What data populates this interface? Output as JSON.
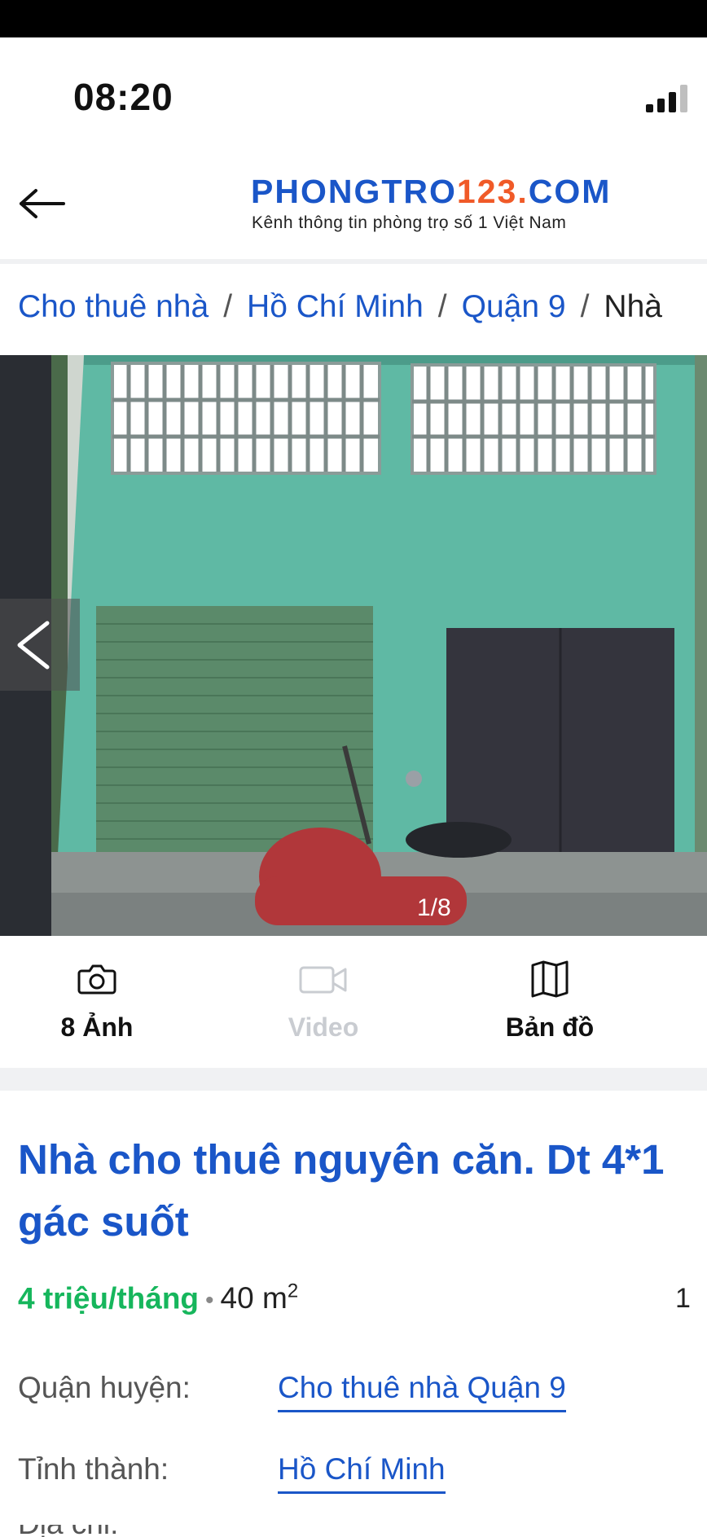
{
  "status_bar": {
    "time": "08:20"
  },
  "header": {
    "logo_main": "PHONGTRO",
    "logo_num": "123",
    "logo_dot": ".",
    "logo_tld": "COM",
    "tagline": "Kênh thông tin phòng trọ số 1 Việt Nam"
  },
  "breadcrumb": {
    "items": [
      "Cho thuê nhà",
      "Hồ Chí Minh",
      "Quận 9",
      "Nhà"
    ],
    "separator": "/"
  },
  "gallery": {
    "counter": "1/8"
  },
  "media_tabs": [
    {
      "label": "8 Ảnh",
      "icon": "camera-icon"
    },
    {
      "label": "Video",
      "icon": "video-icon"
    },
    {
      "label": "Bản đồ",
      "icon": "map-icon"
    }
  ],
  "post": {
    "title_line1": "Nhà cho thuê nguyên căn. Dt 4*1",
    "title_line2": "gác suốt",
    "price": "4 triệu/tháng",
    "bullet": "•",
    "area": "40 m",
    "area_sup": "2",
    "price_extra": "1",
    "district_label": "Quận huyện:",
    "district_value": "Cho thuê nhà Quận 9",
    "city_label": "Tỉnh thành:",
    "city_value": "Hồ Chí Minh",
    "next_row_partial": "Địa chỉ:"
  },
  "colors": {
    "brand_blue": "#1a56c8",
    "brand_orange": "#f05a28",
    "price_green": "#16b65c",
    "disabled_gray": "#c9ccd1"
  }
}
